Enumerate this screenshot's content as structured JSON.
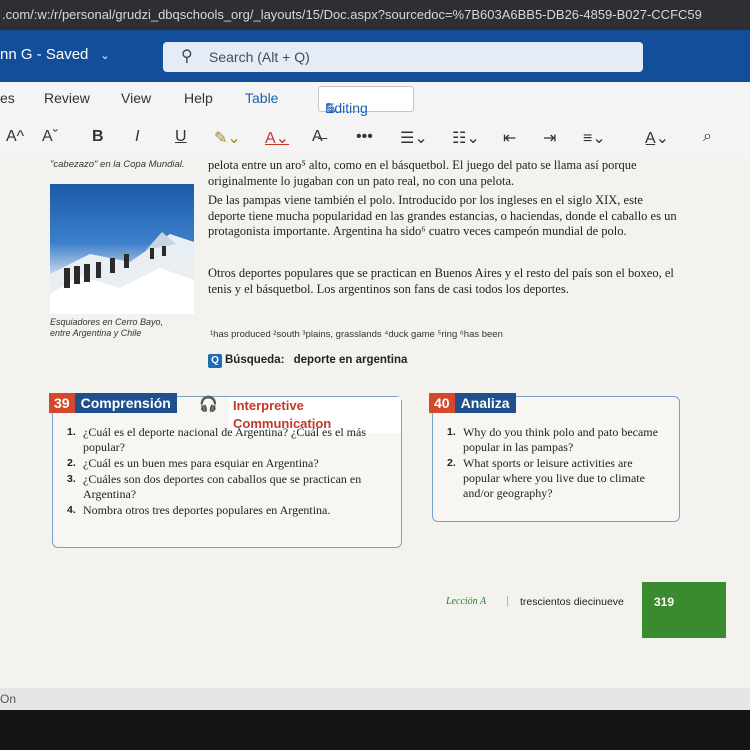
{
  "browser": {
    "url": ".com/:w:/r/personal/grudzi_dbqschools_org/_layouts/15/Doc.aspx?sourcedoc=%7B603A6BB5-DB26-4859-B027-CCFC59"
  },
  "titlebar": {
    "doc_title": "nn G  -  Saved",
    "search_placeholder": "Search (Alt + Q)"
  },
  "menu": {
    "items": [
      "es",
      "Review",
      "View",
      "Help",
      "Table"
    ],
    "editing_label": "Editing"
  },
  "toolbar": {
    "grow": "A^",
    "shrink": "Aˇ",
    "bold": "B",
    "italic": "I",
    "underline": "U",
    "more": "•••",
    "find": "⌕"
  },
  "document": {
    "caption_top": "\"cabezazo\" en la Copa Mundial.",
    "caption_photo": [
      "Esquiadores en Cerro Bayo,",
      "entre Argentina y Chile"
    ],
    "paragraphs": [
      "pelota entre un aro⁵ alto, como en el básquetbol. El juego del pato se llama así porque originalmente lo jugaban con un pato real, no con una pelota.",
      "De las pampas viene también el polo. Introducido por los ingleses en el siglo XIX, este deporte tiene mucha popularidad en las grandes estancias, o haciendas, donde el caballo es un protagonista importante. Argentina ha sido⁶ cuatro veces campeón mundial de polo.",
      "Otros deportes populares que se practican en Buenos Aires y el resto del país son el boxeo, el tenis y el básquetbol. Los argentinos son fans de casi todos los deportes."
    ],
    "footnotes": "¹has produced   ²south   ³plains, grasslands   ⁴duck game   ⁵ring   ⁶has been",
    "busqueda_label": "Búsqueda:",
    "busqueda_term": "deporte en argentina",
    "comprension": {
      "number": "39",
      "title": "Comprensión",
      "subtitle": "Interpretive Communication",
      "questions": [
        "¿Cuál es el deporte nacional de Argentina? ¿Cuál es el más popular?",
        "¿Cuál es un buen mes para esquiar en Argentina?",
        "¿Cuáles son dos deportes con caballos que se practican en Argentina?",
        "Nombra otros tres deportes populares en Argentina."
      ]
    },
    "analiza": {
      "number": "40",
      "title": "Analiza",
      "questions": [
        "Why do you think polo and pato became popular in las pampas?",
        "What sports or leisure activities are popular where you live due to climate and/or geography?"
      ]
    },
    "footer": {
      "leccion": "Lección A",
      "page_words": "trescientos diecinueve",
      "page_number": "319"
    }
  },
  "status": {
    "text": "On"
  },
  "colors": {
    "titlebar": "#124e9a",
    "accent_red": "#d5482c",
    "box_head": "#1f4f8d",
    "page_green": "#3a8a2f"
  }
}
